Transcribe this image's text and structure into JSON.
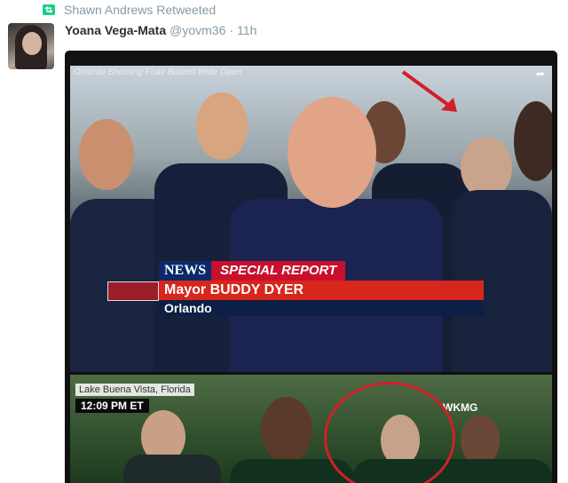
{
  "retweet": {
    "icon": "retweet-icon",
    "label": "Shawn Andrews Retweeted"
  },
  "tweet": {
    "name": "Yoana Vega-Mata",
    "handle": "@yovm36",
    "separator": "·",
    "time": "11h"
  },
  "media": {
    "top_caption": "Orlando Shooting Foax Busted Wide Open",
    "share_icon": "share-icon",
    "network": "NEWS",
    "banner": "SPECIAL REPORT",
    "name_bar": "Mayor BUDDY DYER",
    "location_bar": "Orlando",
    "bottom_location": "Lake Buena Vista, Florida",
    "bottom_time": "12:09 PM ET",
    "station": "WKMG"
  },
  "colors": {
    "retweet_green": "#19cf86",
    "meta_grey": "#8899a6",
    "name_dark": "#292f33",
    "annotation_red": "#d21f27"
  }
}
